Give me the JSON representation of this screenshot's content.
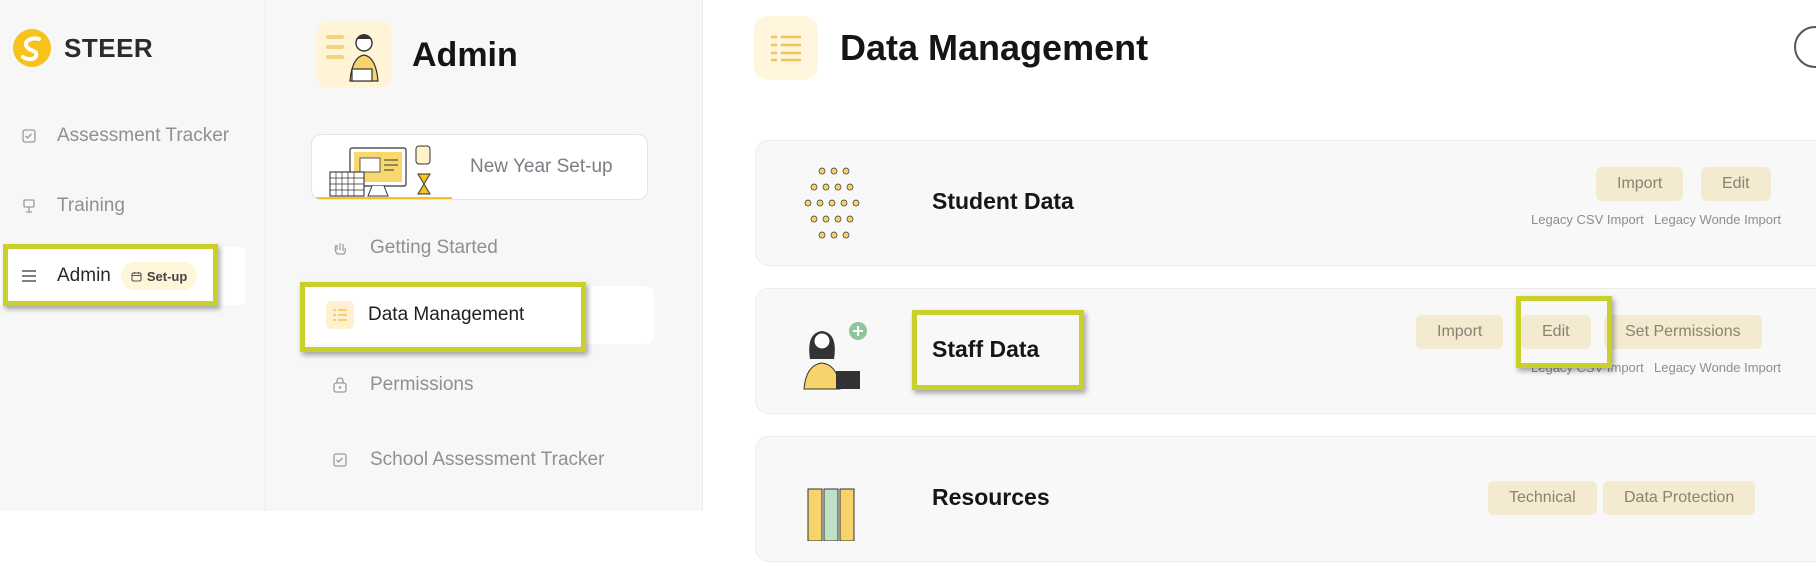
{
  "brand": {
    "name": "STEER"
  },
  "sidebar": {
    "items": [
      {
        "label": "Assessment Tracker",
        "icon": "checklist-icon"
      },
      {
        "label": "Training",
        "icon": "easel-icon"
      },
      {
        "label": "Admin",
        "icon": "menu-icon",
        "badge": "Set-up"
      }
    ]
  },
  "admin": {
    "title": "Admin",
    "new_year_card": "New Year Set-up",
    "items": [
      {
        "label": "Getting Started"
      },
      {
        "label": "Data Management"
      },
      {
        "label": "Permissions"
      },
      {
        "label": "School Assessment Tracker"
      }
    ]
  },
  "main": {
    "title": "Data Management",
    "cards": [
      {
        "title": "Student Data",
        "buttons": [
          "Import",
          "Edit"
        ],
        "links": [
          "Legacy CSV Import",
          "Legacy Wonde Import"
        ]
      },
      {
        "title": "Staff Data",
        "buttons": [
          "Import",
          "Edit",
          "Set Permissions"
        ],
        "links": [
          "Legacy CSV Import",
          "Legacy Wonde Import"
        ]
      },
      {
        "title": "Resources",
        "buttons": [
          "Technical",
          "Data Protection"
        ]
      }
    ]
  },
  "colors": {
    "accent": "#f4ead0",
    "highlight": "#c9d02a",
    "brand_yellow": "#f6c21b"
  }
}
